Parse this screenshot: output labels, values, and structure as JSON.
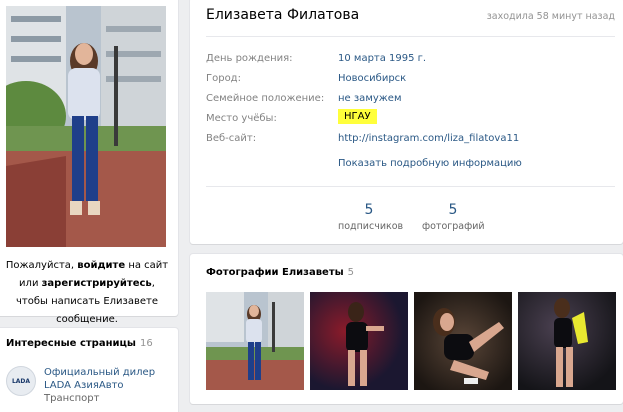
{
  "profile": {
    "name": "Елизавета Филатова",
    "last_seen": "заходила 58 минут назад",
    "info": [
      {
        "label": "День рождения:",
        "value": "10 марта 1995 г."
      },
      {
        "label": "Город:",
        "value": "Новосибирск"
      },
      {
        "label": "Семейное положение:",
        "value": "не замужем"
      },
      {
        "label": "Место учёбы:",
        "value": "НГАУ"
      },
      {
        "label": "Веб-сайт:",
        "value": "http://instagram.com/liza_filatova11"
      }
    ],
    "more_info": "Показать подробную информацию",
    "stats": [
      {
        "count": "5",
        "label": "подписчиков"
      },
      {
        "count": "5",
        "label": "фотографий"
      }
    ]
  },
  "login_note": {
    "p1": "Пожалуйста, ",
    "login": "войдите",
    "p2": " на сайт или ",
    "register": "зарегистрируйтесь",
    "p3": ", чтобы написать Елизавете сообщение."
  },
  "interests": {
    "title": "Интересные страницы",
    "count": "16",
    "items": [
      {
        "logo": "LADA",
        "name": "Официальный дилер LADA АзияАвто",
        "category": "Транспорт"
      }
    ]
  },
  "photos": {
    "title": "Фотографии Елизаветы",
    "count": "5"
  },
  "colors": {
    "link": "#2a5885",
    "highlight": "#ffff3b",
    "page_bg": "#edeef0"
  }
}
